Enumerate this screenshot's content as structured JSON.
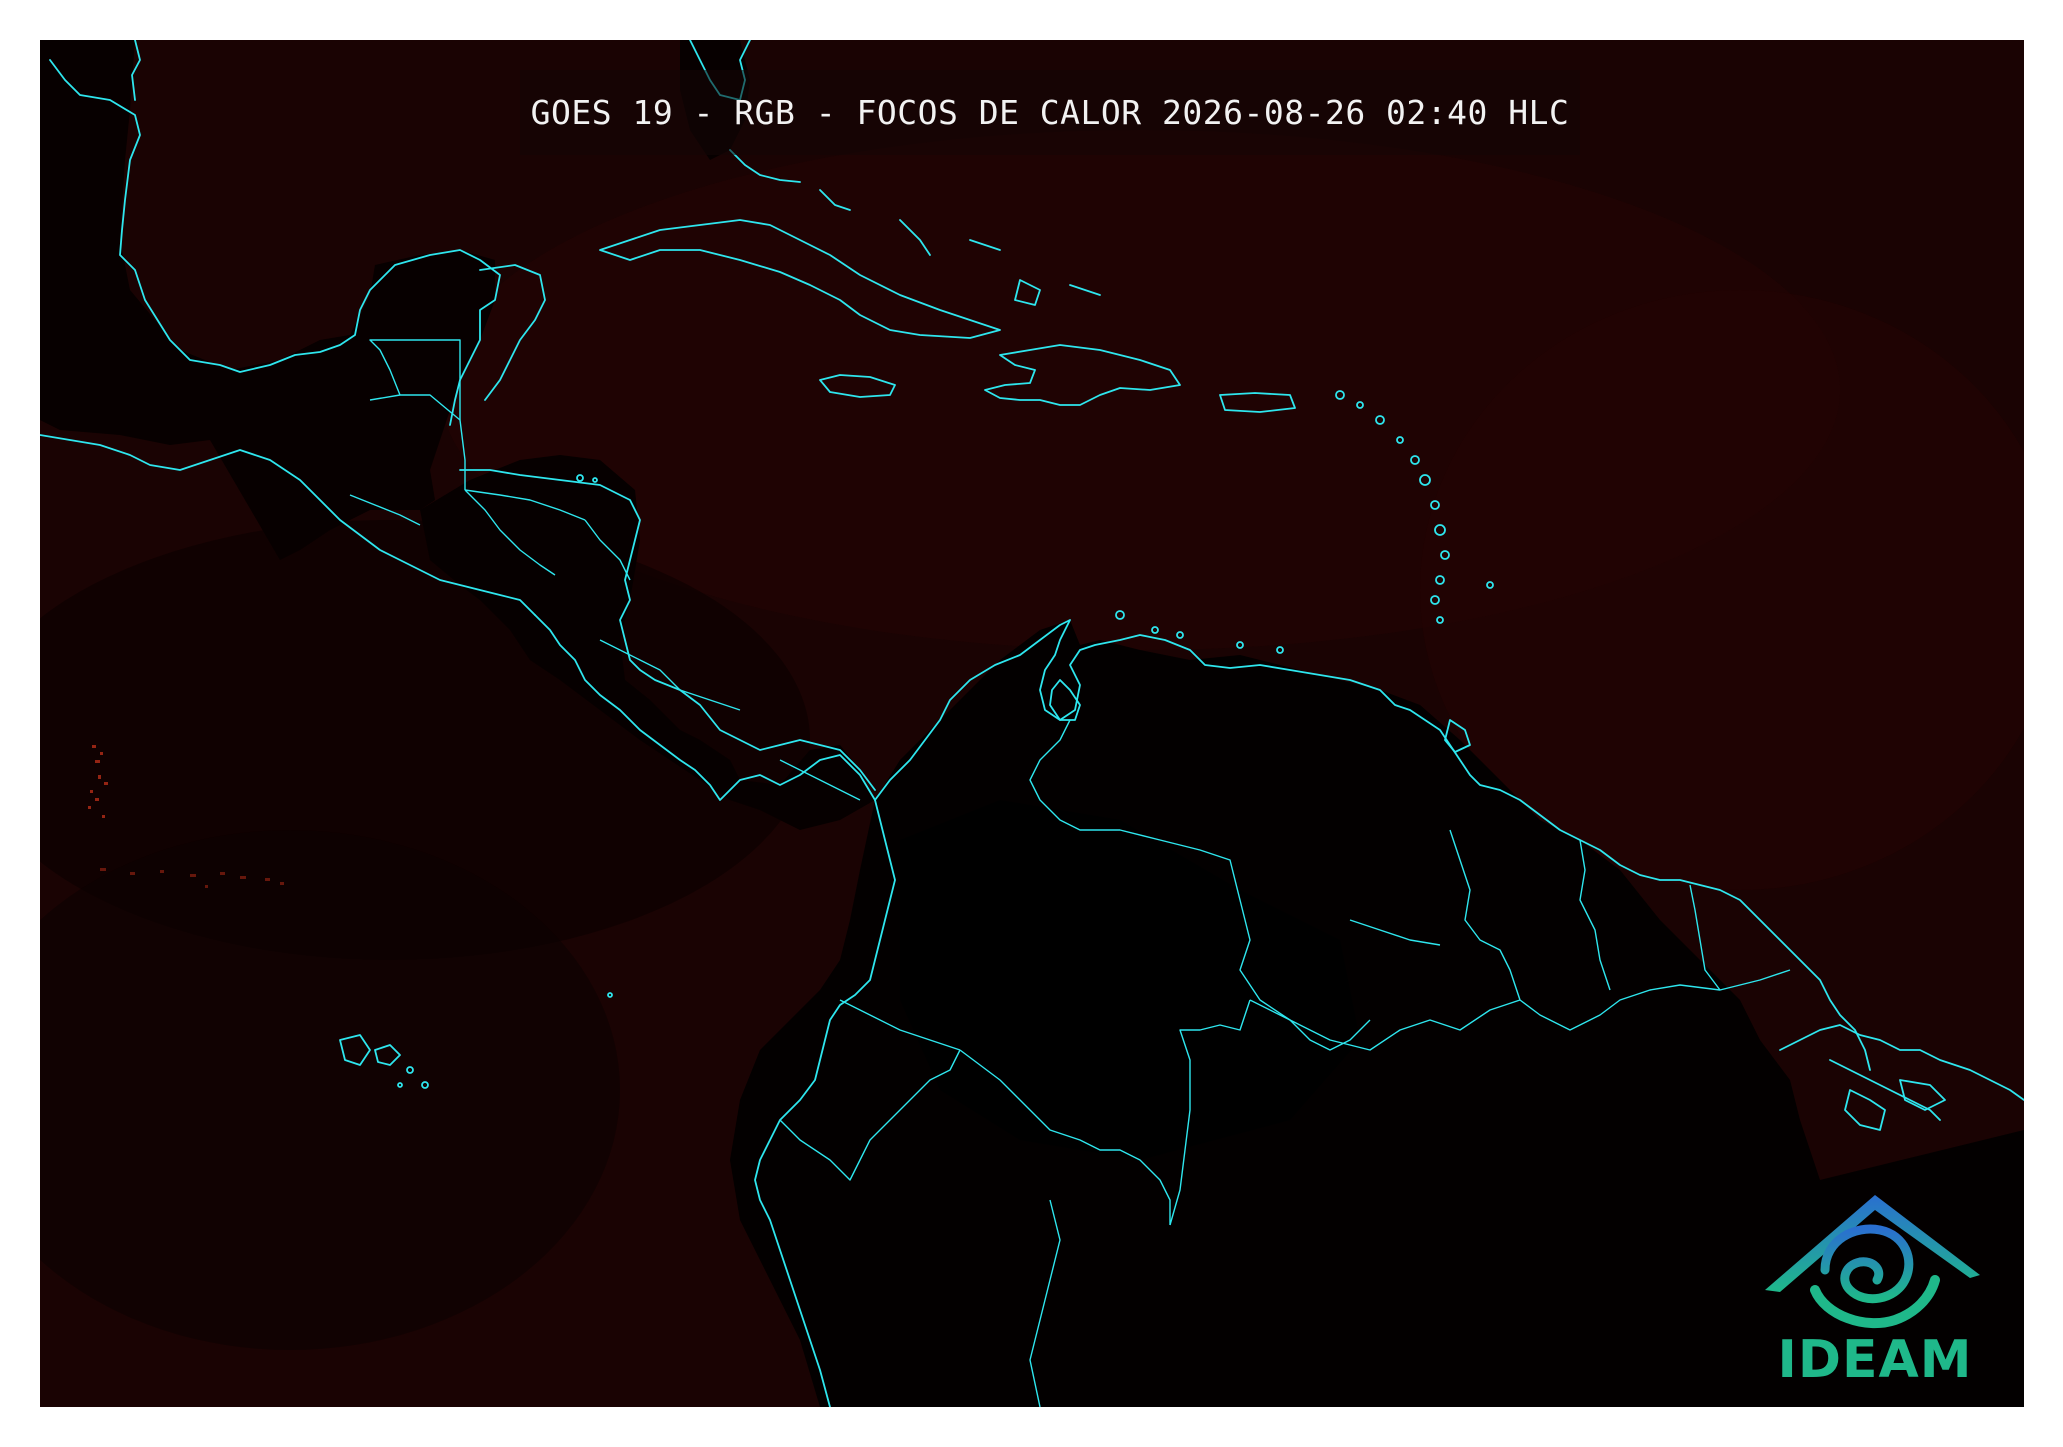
{
  "map": {
    "title": "GOES 19 - RGB - FOCOS DE CALOR 2026-08-26 02:40 HLC",
    "colors": {
      "background": "#120202",
      "ocean_tint": "#1c0303",
      "land_dark": "#050000",
      "coastline": "#2ee6ee",
      "hotspot": "#c0301a"
    }
  },
  "logo": {
    "text": "IDEAM",
    "icon": "ideam-mountain-swirl-icon",
    "colors": {
      "mountain_top": "#2a6fd0",
      "mountain_base": "#1fb88a"
    }
  }
}
